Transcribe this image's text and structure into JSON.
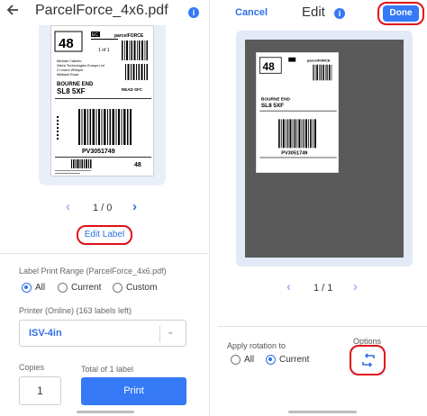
{
  "left": {
    "title": "ParcelForce_4x6.pdf",
    "info_icon_glyph": "i",
    "pager_text": "1 / 0",
    "edit_label": "Edit Label",
    "range_label": "Label Print Range (ParcelForce_4x6.pdf)",
    "range_options": [
      "All",
      "Current",
      "Custom"
    ],
    "range_selected": "All",
    "printer_label": "Printer (Online) (163 labels left)",
    "printer_value": "ISV-4in",
    "copies_label": "Copies",
    "copies_value": "1",
    "total_label": "Total of 1 label",
    "print_label": "Print"
  },
  "right": {
    "cancel_label": "Cancel",
    "title": "Edit",
    "info_icon_glyph": "i",
    "done_label": "Done",
    "pager_text": "1 / 1",
    "rotation_label": "Apply rotation to",
    "rotation_options": [
      "All",
      "Current"
    ],
    "rotation_selected": "Current",
    "options_label": "Options"
  },
  "label_preview": {
    "number": "48",
    "service_code": "EC",
    "brand": "parcelFORCE",
    "of_text": "1 of 1",
    "sender_lines": [
      "Michael Cabrelo",
      "Zebra Technologies Europe Ltd",
      "2 Lovers Whisper",
      "Millbank Road"
    ],
    "dest_town": "BOURNE END",
    "dest_postcode": "SL8 5XF",
    "route_code": "READ SFC",
    "tracking": "PV3051749",
    "small_number": "48"
  },
  "colors": {
    "accent": "#3579f6",
    "highlight": "#e0101a",
    "canvas_bg": "#5a5a5a"
  }
}
